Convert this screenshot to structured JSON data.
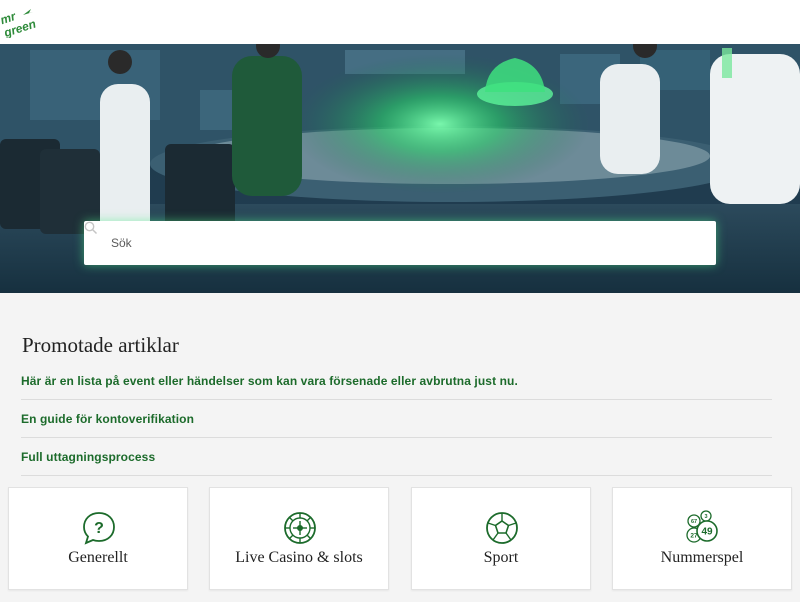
{
  "brand": {
    "name": "mr green",
    "logo_text": "mr green",
    "accent": "#1c6b2b",
    "logo_color": "#2e8b3a"
  },
  "hero": {
    "glow_color": "#3df080"
  },
  "search": {
    "placeholder": "Sök",
    "value": ""
  },
  "promoted": {
    "title": "Promotade artiklar",
    "items": [
      {
        "label": "Här är en lista på event eller händelser som kan vara försenade eller avbrutna just nu."
      },
      {
        "label": "En guide för kontoverifikation"
      },
      {
        "label": "Full uttagningsprocess"
      }
    ]
  },
  "categories": [
    {
      "label": "Generellt",
      "icon": "question-icon"
    },
    {
      "label": "Live Casino & slots",
      "icon": "roulette-icon"
    },
    {
      "label": "Sport",
      "icon": "football-icon"
    },
    {
      "label": "Nummerspel",
      "icon": "lottery-balls-icon",
      "ball_numbers": [
        "67",
        "3",
        "27",
        "49"
      ]
    }
  ]
}
